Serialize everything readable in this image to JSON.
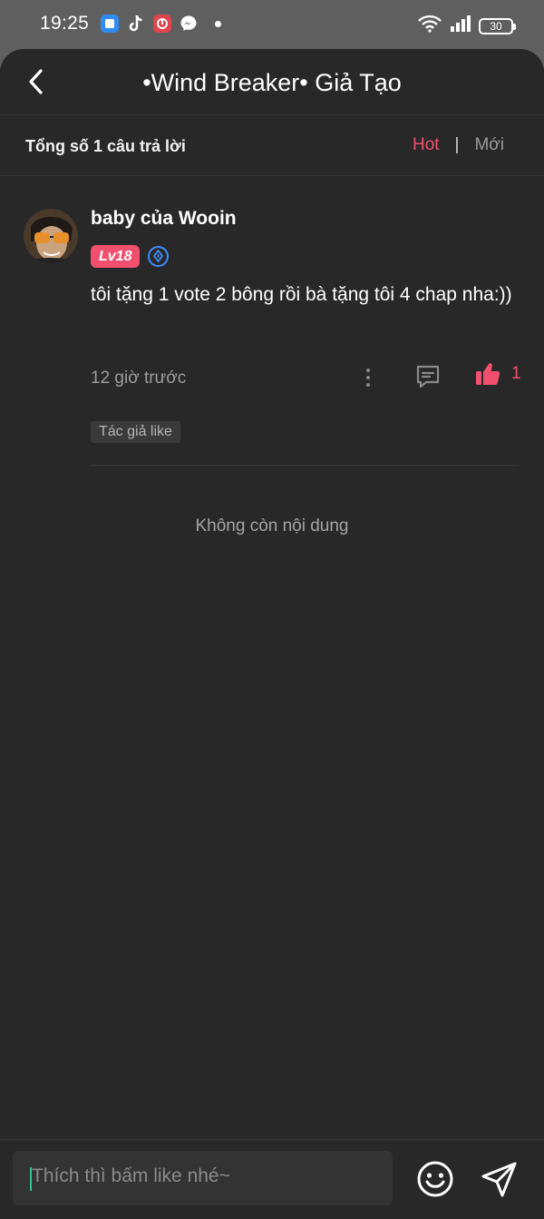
{
  "status_bar": {
    "time": "19:25",
    "battery": "30",
    "apps": [
      {
        "icon": "blue-square-app-icon",
        "color": "#2f8cf0"
      },
      {
        "icon": "tiktok-icon",
        "color": "#111111"
      },
      {
        "icon": "red-app-icon",
        "color": "#e0454e"
      },
      {
        "icon": "messenger-icon",
        "color": "#2d7ff9"
      }
    ]
  },
  "header": {
    "back_icon": "chevron-left-icon",
    "title": "•Wind Breaker• Giả Tạo"
  },
  "summary": {
    "total": "Tổng số 1 câu trả lời",
    "sort_hot": "Hot",
    "sort_separator": "|",
    "sort_new": "Mới"
  },
  "comment": {
    "username": "baby của Wooin",
    "level": "Lv18",
    "text": "tôi tặng 1 vote 2 bông rồi bà tặng tôi 4 chap nha:))",
    "time": "12 giờ trước",
    "like_count": "1",
    "tag": "Tác giả like"
  },
  "end_text": "Không còn nội dung",
  "composer": {
    "placeholder": "Thích thì bấm like nhé~"
  },
  "colors": {
    "accent": "#f0506e",
    "background": "#282828",
    "caret": "#2ec38f",
    "vip": "#3f8cff"
  }
}
